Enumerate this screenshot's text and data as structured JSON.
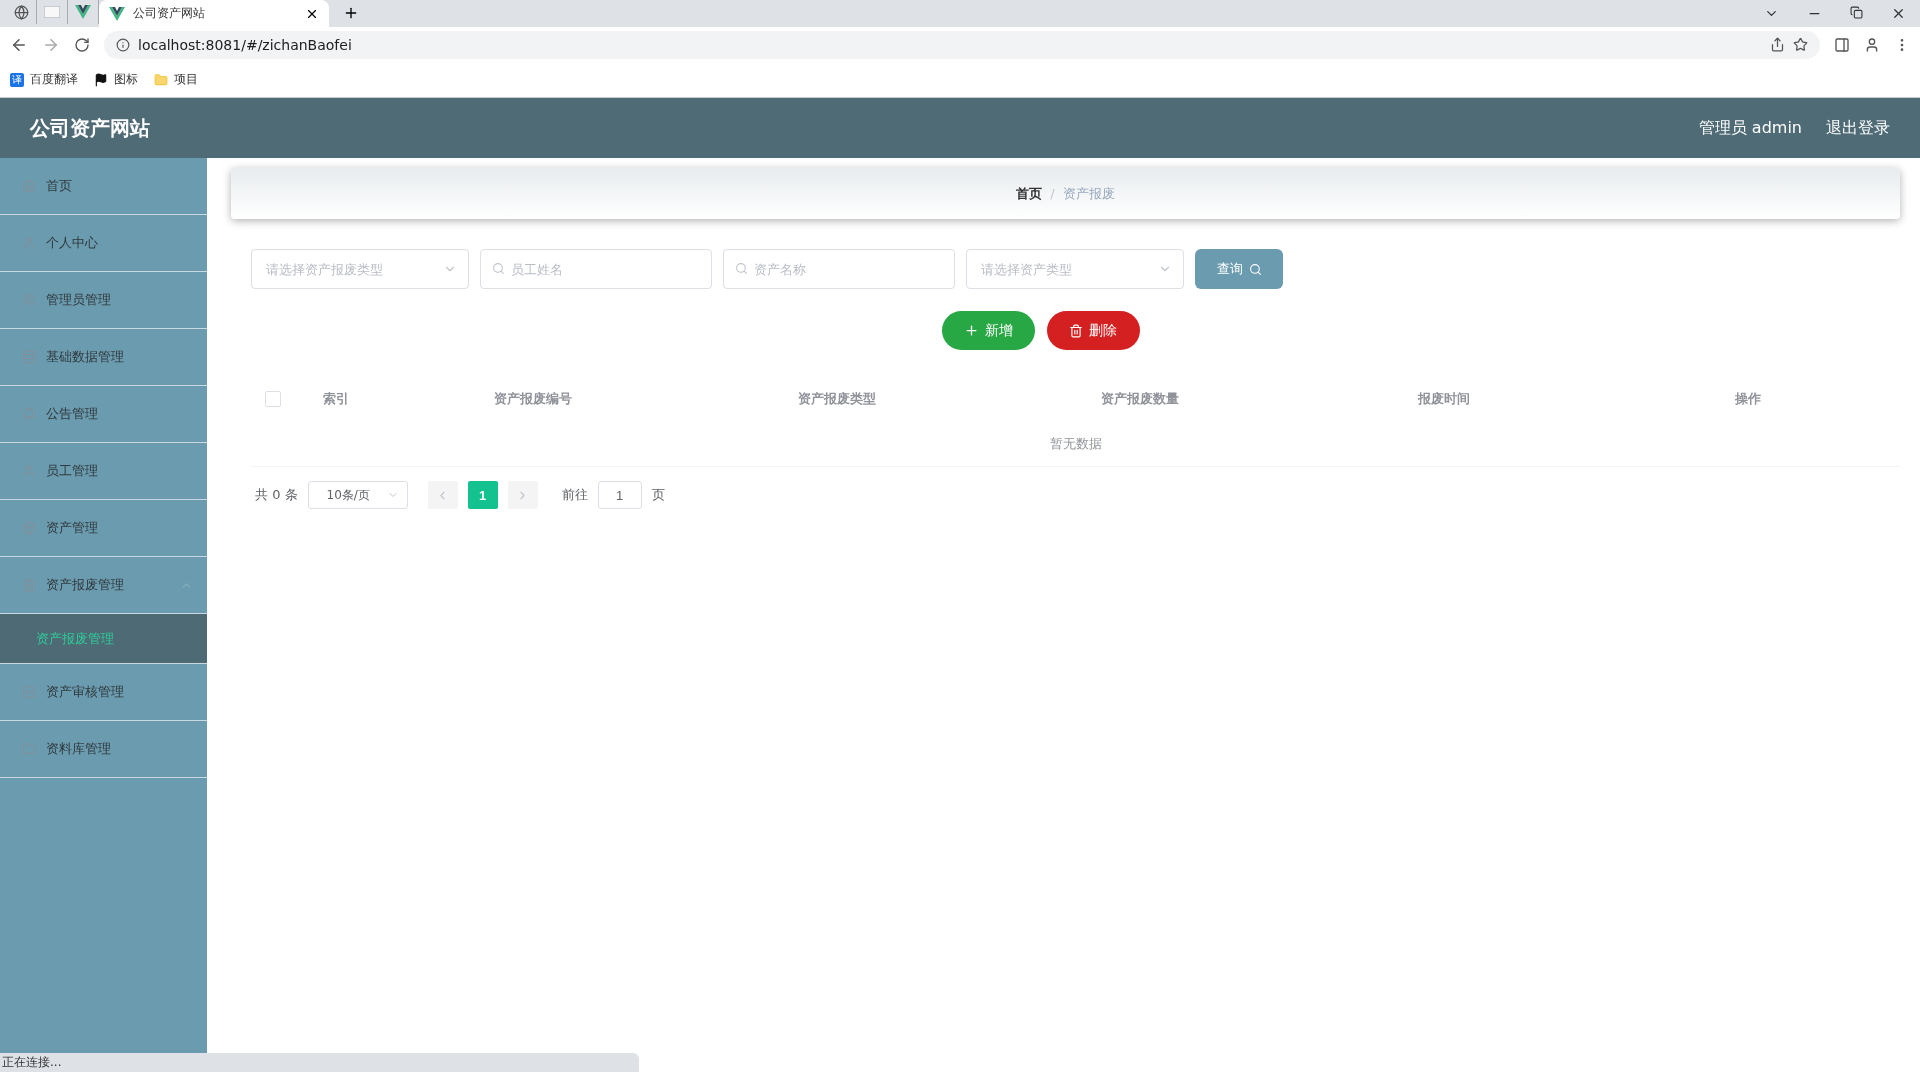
{
  "browser": {
    "tabs": [
      {
        "kind": "globe",
        "selected": false
      },
      {
        "kind": "blank",
        "selected": false
      },
      {
        "kind": "vue",
        "selected": false
      },
      {
        "kind": "vue",
        "title": "公司资产网站",
        "selected": true
      }
    ],
    "address": "localhost:8081/#/zichanBaofei",
    "bookmarks": [
      {
        "kind": "translate",
        "label": "百度翻译",
        "glyph": "译"
      },
      {
        "kind": "flag",
        "label": "图标"
      },
      {
        "kind": "folder",
        "label": "项目"
      }
    ],
    "status": "正在连接..."
  },
  "header": {
    "title": "公司资产网站",
    "user": "管理员 admin",
    "logout": "退出登录"
  },
  "sidebar": {
    "items": [
      {
        "label": "首页"
      },
      {
        "label": "个人中心"
      },
      {
        "label": "管理员管理"
      },
      {
        "label": "基础数据管理"
      },
      {
        "label": "公告管理"
      },
      {
        "label": "员工管理"
      },
      {
        "label": "资产管理"
      },
      {
        "label": "资产报废管理",
        "expanded": true,
        "children": [
          {
            "label": "资产报废管理",
            "selected": true
          }
        ]
      },
      {
        "label": "资产审核管理"
      },
      {
        "label": "资料库管理"
      }
    ]
  },
  "breadcrumb": [
    {
      "label": "首页",
      "current": false
    },
    {
      "label": "资产报废",
      "current": true
    }
  ],
  "breadcrumb_separator": "/",
  "filters": [
    {
      "kind": "select",
      "placeholder": "请选择资产报废类型"
    },
    {
      "kind": "search",
      "placeholder": "员工姓名"
    },
    {
      "kind": "search",
      "placeholder": "资产名称"
    },
    {
      "kind": "select",
      "placeholder": "请选择资产类型"
    }
  ],
  "query_button": "查询",
  "actions": [
    {
      "kind": "add",
      "label": "新增"
    },
    {
      "kind": "delete",
      "label": "删除"
    }
  ],
  "table": {
    "all_checked": false,
    "columns": [
      "索引",
      "资产报废编号",
      "资产报废类型",
      "资产报废数量",
      "报废时间",
      "操作"
    ],
    "empty": "暂无数据"
  },
  "pagination": {
    "total": "共 0 条",
    "page_size": "10条/页",
    "pages": [
      {
        "label": "1",
        "selected": true
      }
    ],
    "goto_label": "前往",
    "goto_value": "1",
    "goto_suffix": "页"
  }
}
